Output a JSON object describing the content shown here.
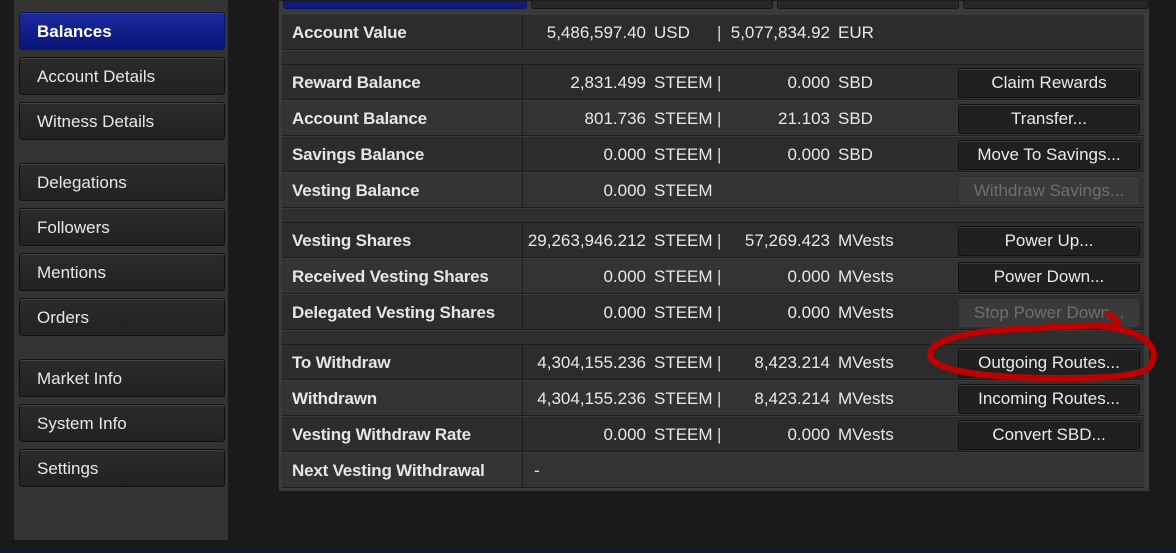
{
  "sidebar": {
    "groups": [
      [
        {
          "label": "Balances",
          "active": true
        },
        {
          "label": "Account Details",
          "active": false
        },
        {
          "label": "Witness Details",
          "active": false
        }
      ],
      [
        {
          "label": "Delegations",
          "active": false
        },
        {
          "label": "Followers",
          "active": false
        },
        {
          "label": "Mentions",
          "active": false
        },
        {
          "label": "Orders",
          "active": false
        }
      ],
      [
        {
          "label": "Market Info",
          "active": false
        },
        {
          "label": "System Info",
          "active": false
        },
        {
          "label": "Settings",
          "active": false
        }
      ]
    ]
  },
  "account_value": {
    "label": "Account Value",
    "usd": "5,486,597.40",
    "usd_unit": "USD",
    "eur": "5,077,834.92",
    "eur_unit": "EUR",
    "pipe": "|"
  },
  "sections": [
    [
      {
        "label": "Reward Balance",
        "v1": "2,831.499",
        "u1": "STEEM",
        "v2": "0.000",
        "u2": "SBD",
        "button": "Claim Rewards",
        "disabled": false
      },
      {
        "label": "Account Balance",
        "v1": "801.736",
        "u1": "STEEM",
        "v2": "21.103",
        "u2": "SBD",
        "button": "Transfer...",
        "disabled": false
      },
      {
        "label": "Savings Balance",
        "v1": "0.000",
        "u1": "STEEM",
        "v2": "0.000",
        "u2": "SBD",
        "button": "Move To Savings...",
        "disabled": false
      },
      {
        "label": "Vesting Balance",
        "v1": "0.000",
        "u1": "STEEM",
        "v2": "",
        "u2": "",
        "button": "Withdraw Savings...",
        "disabled": true
      }
    ],
    [
      {
        "label": "Vesting Shares",
        "v1": "29,263,946.212",
        "u1": "STEEM",
        "v2": "57,269.423",
        "u2": "MVests",
        "button": "Power Up...",
        "disabled": false
      },
      {
        "label": "Received Vesting Shares",
        "v1": "0.000",
        "u1": "STEEM",
        "v2": "0.000",
        "u2": "MVests",
        "button": "Power Down...",
        "disabled": false
      },
      {
        "label": "Delegated Vesting Shares",
        "v1": "0.000",
        "u1": "STEEM",
        "v2": "0.000",
        "u2": "MVests",
        "button": "Stop Power Down...",
        "disabled": true
      }
    ],
    [
      {
        "label": "To Withdraw",
        "v1": "4,304,155.236",
        "u1": "STEEM",
        "v2": "8,423.214",
        "u2": "MVests",
        "button": "Outgoing Routes...",
        "disabled": false
      },
      {
        "label": "Withdrawn",
        "v1": "4,304,155.236",
        "u1": "STEEM",
        "v2": "8,423.214",
        "u2": "MVests",
        "button": "Incoming Routes...",
        "disabled": false
      },
      {
        "label": "Vesting Withdraw Rate",
        "v1": "0.000",
        "u1": "STEEM",
        "v2": "0.000",
        "u2": "MVests",
        "button": "Convert SBD...",
        "disabled": false
      },
      {
        "label": "Next Vesting Withdrawal",
        "v1": "-",
        "u1": "",
        "v2": "",
        "u2": "",
        "button": "",
        "disabled": false
      }
    ]
  ],
  "annotation": {
    "color": "#c00000"
  }
}
